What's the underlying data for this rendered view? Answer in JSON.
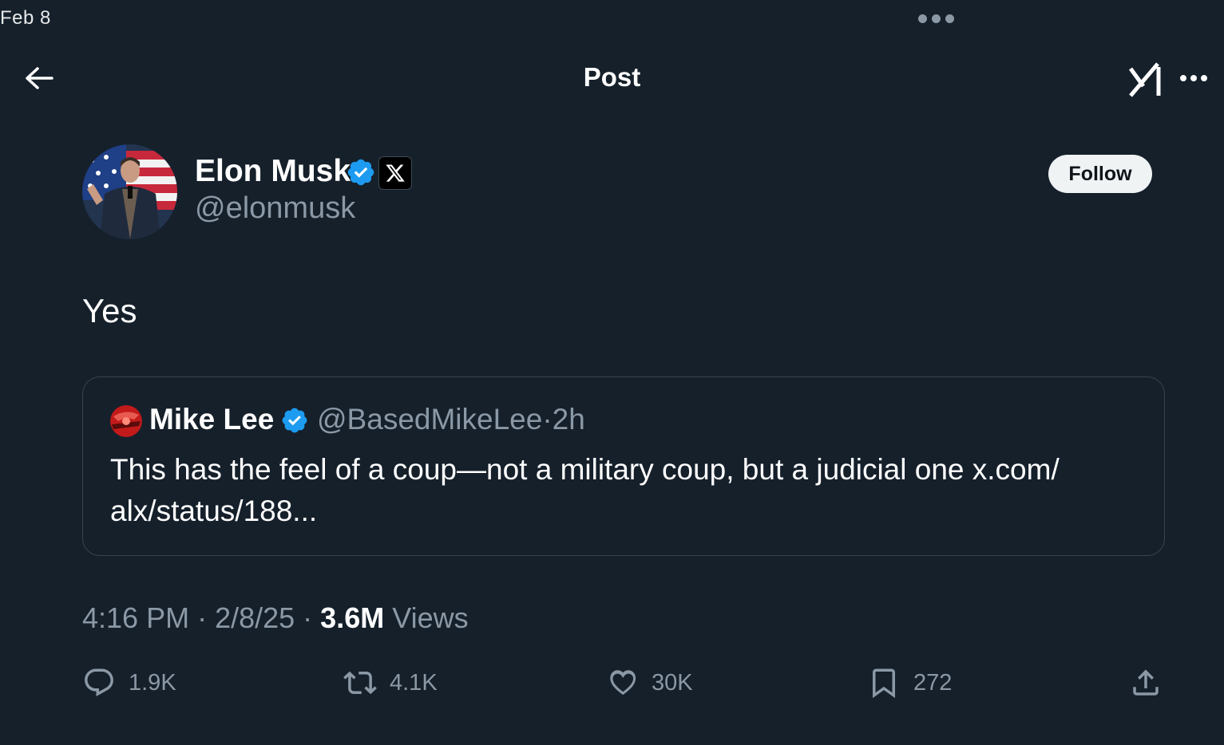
{
  "status_bar": {
    "date": "Feb 8"
  },
  "nav": {
    "title": "Post"
  },
  "post": {
    "author_name": "Elon Musk",
    "author_handle": "@elonmusk",
    "follow_label": "Follow",
    "text": "Yes",
    "quote": {
      "author_name": "Mike Lee",
      "author_handle": "@BasedMikeLee",
      "separator": "·",
      "time": "2h",
      "text": "This has the feel of a coup—not a military coup, but a judicial one x.com/ alx/status/188..."
    },
    "meta": {
      "time": "4:16 PM",
      "sep1": " · ",
      "date": "2/8/25",
      "sep2": " · ",
      "views": "3.6M",
      "views_label": " Views"
    },
    "actions": {
      "replies": "1.9K",
      "reposts": "4.1K",
      "likes": "30K",
      "bookmarks": "272"
    }
  },
  "colors": {
    "background": "#15202b",
    "verified": "#1d9bf0",
    "secondary_text": "#8b98a5",
    "border": "#38444d"
  },
  "icons": [
    "back-arrow-icon",
    "grok-icon",
    "more-icon",
    "verified-icon",
    "x-logo-icon",
    "reply-icon",
    "repost-icon",
    "like-icon",
    "bookmark-icon",
    "share-icon"
  ]
}
